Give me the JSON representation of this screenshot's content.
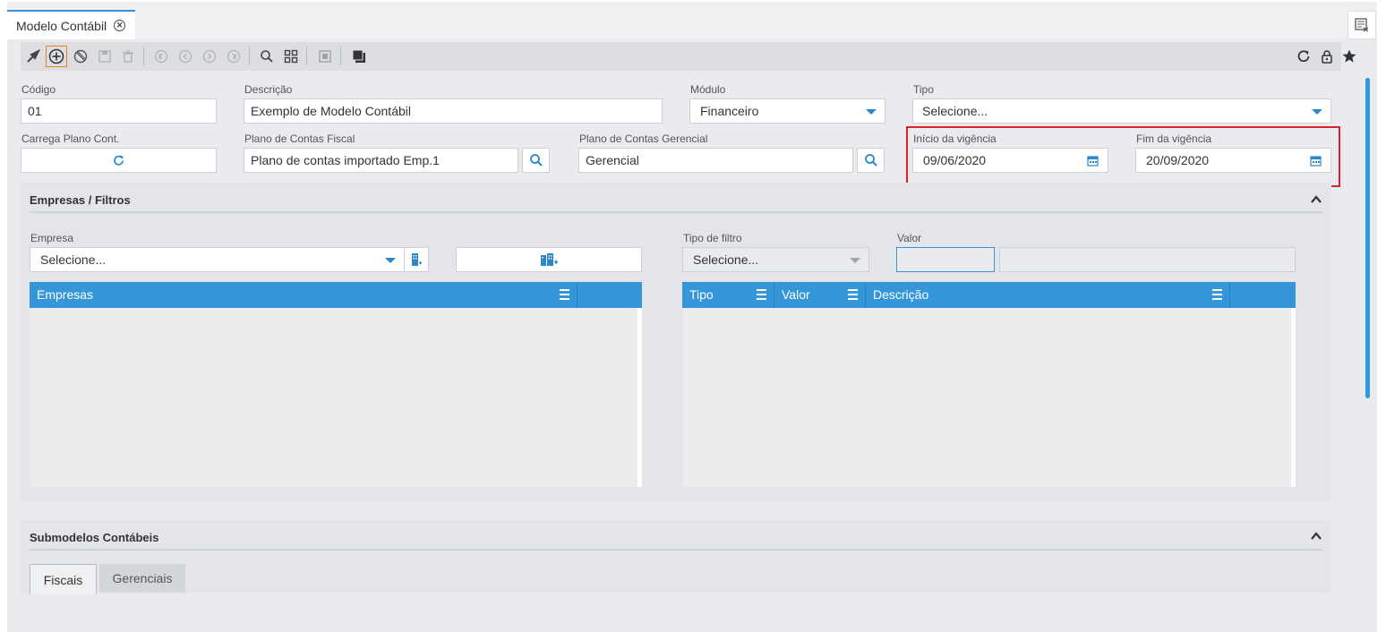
{
  "tab": {
    "title": "Modelo Contábil"
  },
  "form": {
    "codigo": {
      "label": "Código",
      "value": "01"
    },
    "descricao": {
      "label": "Descrição",
      "value": "Exemplo de Modelo Contábil"
    },
    "modulo": {
      "label": "Módulo",
      "value": "Financeiro"
    },
    "tipo": {
      "label": "Tipo",
      "value": "Selecione..."
    },
    "carrega": {
      "label": "Carrega Plano Cont."
    },
    "plano_fiscal": {
      "label": "Plano de Contas Fiscal",
      "value": "Plano de contas importado Emp.1"
    },
    "plano_gerencial": {
      "label": "Plano de Contas Gerencial",
      "value": "Gerencial"
    },
    "inicio": {
      "label": "Início da vigência",
      "value": "09/06/2020"
    },
    "fim": {
      "label": "Fim da vigência",
      "value": "20/09/2020"
    }
  },
  "empresas_filtros": {
    "title": "Empresas / Filtros",
    "empresa": {
      "label": "Empresa",
      "value": "Selecione..."
    },
    "tipo_filtro": {
      "label": "Tipo de filtro",
      "value": "Selecione..."
    },
    "valor": {
      "label": "Valor"
    },
    "grid_empresas": {
      "columns": [
        "Empresas"
      ]
    },
    "grid_filtros": {
      "columns": [
        "Tipo",
        "Valor",
        "Descrição"
      ]
    }
  },
  "submodelos": {
    "title": "Submodelos Contábeis",
    "tabs": [
      "Fiscais",
      "Gerenciais"
    ]
  },
  "colors": {
    "accent": "#3597d9",
    "highlight": "#d9242c"
  }
}
